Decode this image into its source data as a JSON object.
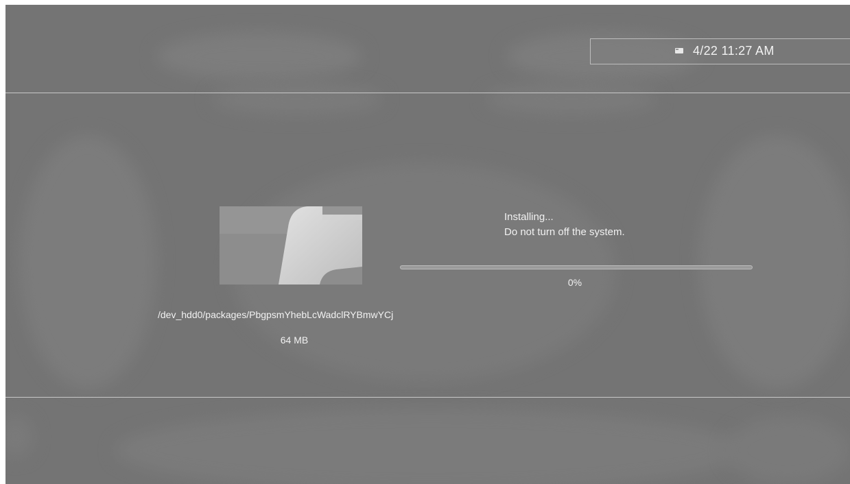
{
  "header": {
    "clock": "4/22 11:27 AM",
    "notification_icon": "mail-icon"
  },
  "install": {
    "thumbnail_icon": "package-icon",
    "package_path": "/dev_hdd0/packages/PbgpsmYhebLcWadclRYBmwYCj",
    "package_size": "64 MB",
    "status_line1": "Installing...",
    "status_line2": "Do not turn off the system.",
    "progress": 0,
    "progress_label": "0%"
  },
  "colors": {
    "background": "#747474",
    "text": "#f2f2f2",
    "lines": "#c9c9c9"
  }
}
